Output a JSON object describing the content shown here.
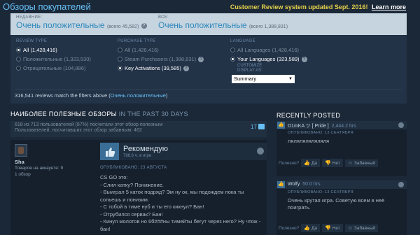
{
  "header": {
    "title": "Обзоры покупателей",
    "notice": "Customer Review system updated Sept. 2016!",
    "learn_more": "Learn more"
  },
  "summary": {
    "recent": {
      "label": "НЕДАВНИЕ:",
      "value": "Очень положительные",
      "count": "(всего 45,582)"
    },
    "all": {
      "label": "ВСЕ:",
      "value": "Очень положительные",
      "count": "(всего 1,388,831)"
    }
  },
  "filters": {
    "review_type": {
      "label": "REVIEW TYPE",
      "options": [
        {
          "label": "All",
          "count": "(1,428,416)",
          "selected": true
        },
        {
          "label": "Положительные",
          "count": "(1,323,530)",
          "selected": false
        },
        {
          "label": "Отрицательные",
          "count": "(104,886)",
          "selected": false
        }
      ]
    },
    "purchase_type": {
      "label": "PURCHASE TYPE",
      "options": [
        {
          "label": "All",
          "count": "(1,428,416)",
          "selected": false
        },
        {
          "label": "Steam Purchasers",
          "count": "(1,388,831)",
          "selected": false
        },
        {
          "label": "Key Activations",
          "count": "(39,585)",
          "selected": true
        }
      ]
    },
    "language": {
      "label": "LANGUAGE",
      "options": [
        {
          "label": "All Languages",
          "count": "(1,428,416)",
          "selected": false
        },
        {
          "label": "Your Languages",
          "count": "(323,589)",
          "selected": true
        }
      ],
      "customize": "CUSTOMIZE",
      "display_as_label": "DISPLAY AS:",
      "display_as_value": "Summary"
    },
    "match_text": "316,541 reviews match the filters above (",
    "match_highlight": "Очень положительные",
    "match_close": ")"
  },
  "helpful": {
    "title": "НАИБОЛЕЕ ПОЛЕЗНЫЕ ОБЗОРЫ",
    "subtitle": "IN THE PAST 30 DAYS",
    "line1": "618 из 713 пользователей (87%) посчитали этот обзор полезным",
    "line2": "Пользователей, посчитавших этот обзор забавным: 462",
    "comment_count": "17"
  },
  "review": {
    "author": "Sha",
    "products_label": "Товаров на аккаунте: 9",
    "reviews_label": "1 обзор",
    "title": "Рекомендую",
    "hours": "786.6 ч. в игре",
    "posted": "ОПУБЛИКОВАНО: 23 АВГУСТА",
    "lines": [
      "CS GO это:",
      "- Слил катку? Понижение.",
      "- Выиграл 5 каток подряд? Эм ну ок, мы подождем пока ты сольешь и понизим.",
      "- С тобой в тиме нуб и ты его кикнул? Бан!",
      "- Отрубился сервак? Бан!",
      "- Кинул молотов но 6б###ны тимейты бегут через него? Ну чтож - бан!"
    ]
  },
  "recent": {
    "title": "RECENTLY POSTED",
    "items": [
      {
        "user": "D1mKA ツ [ Pride ]",
        "hours": "2,444.2 hrs",
        "posted": "ОПУБЛИКОВАНО: 13 СЕНТЯБРЯ",
        "text": "ляляляляляляля",
        "helpful_q": "Полезно?",
        "yes": "Да",
        "no": "Нет",
        "funny": "Забавный"
      },
      {
        "user": "Wolfy",
        "hours": "50.0 hrs",
        "posted": "ОПУБЛИКОВАНО: 13 СЕНТЯБРЯ",
        "text": "Очень крутая игра. Советую всем в неё поиграть.",
        "helpful_q": "Полезно?",
        "yes": "Да",
        "no": "Нет",
        "funny": "Забавный"
      }
    ]
  },
  "colors": {
    "accent": "#66c0f4",
    "background": "#1b2838",
    "notice": "#e6d24a",
    "thumb_up": "#3b6e96"
  },
  "icons": [
    "question-icon",
    "thumbs-up-icon",
    "thumbs-down-icon",
    "steam-icon",
    "comment-icon",
    "smile-icon",
    "dropdown-arrow-icon"
  ]
}
